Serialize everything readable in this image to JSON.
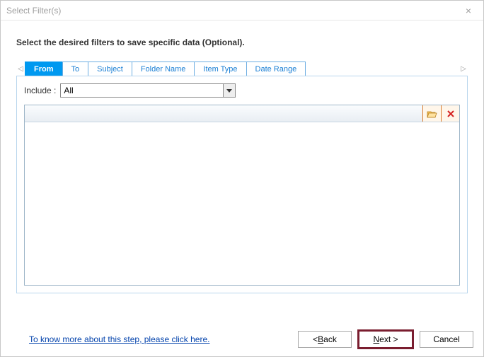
{
  "window": {
    "title": "Select Filter(s)"
  },
  "instruction": "Select the desired filters to save specific data (Optional).",
  "tabs": [
    {
      "label": "From",
      "active": true
    },
    {
      "label": "To",
      "active": false
    },
    {
      "label": "Subject",
      "active": false
    },
    {
      "label": "Folder Name",
      "active": false
    },
    {
      "label": "Item Type",
      "active": false
    },
    {
      "label": "Date Range",
      "active": false
    }
  ],
  "include": {
    "label": "Include :",
    "selected": "All"
  },
  "toolbar": {
    "folder_icon": "folder-open-icon",
    "delete_icon": "delete-icon"
  },
  "help": {
    "text": "To know more about this step, please click here."
  },
  "buttons": {
    "back_pre": "< ",
    "back_mn": "B",
    "back_post": "ack",
    "next_mn": "N",
    "next_post": "ext >",
    "cancel": "Cancel"
  }
}
